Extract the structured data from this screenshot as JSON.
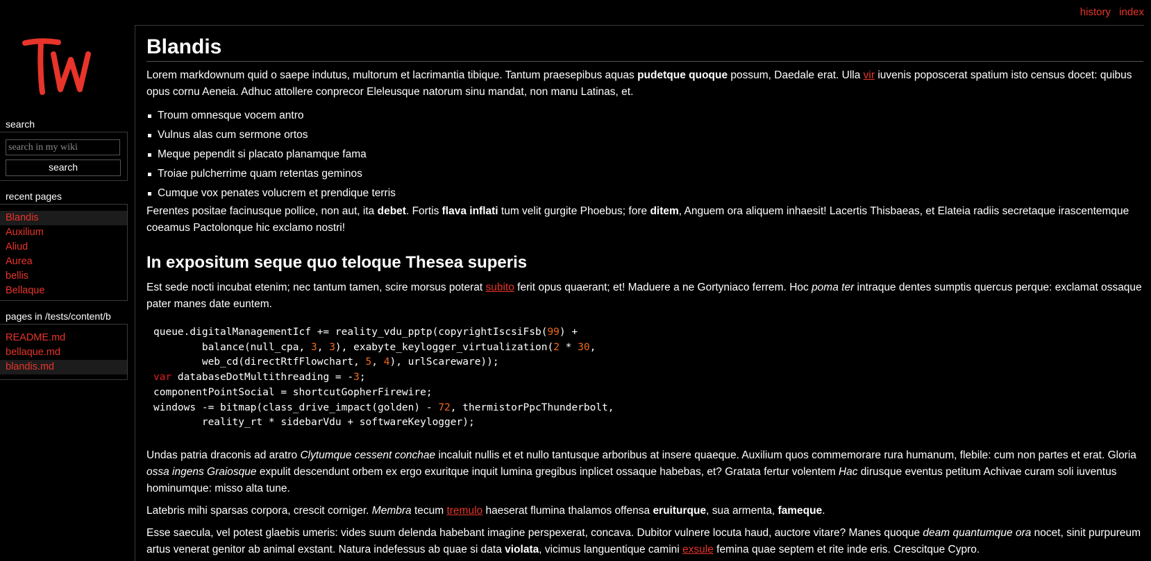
{
  "topnav": {
    "history": "history",
    "index": "index"
  },
  "logo": {
    "text": "Tw",
    "color": "#e8342a"
  },
  "sidebar": {
    "search": {
      "title": "search",
      "placeholder": "search in my wiki",
      "button": "search"
    },
    "recent": {
      "title": "recent pages",
      "items": [
        {
          "label": "Blandis",
          "active": true
        },
        {
          "label": "Auxilium",
          "active": false
        },
        {
          "label": "Aliud",
          "active": false
        },
        {
          "label": "Aurea",
          "active": false
        },
        {
          "label": "bellis",
          "active": false
        },
        {
          "label": "Bellaque",
          "active": false
        }
      ]
    },
    "pages": {
      "title": "pages in /tests/content/b",
      "items": [
        {
          "label": "README.md",
          "active": false
        },
        {
          "label": "bellaque.md",
          "active": false
        },
        {
          "label": "blandis.md",
          "active": true
        }
      ]
    }
  },
  "article": {
    "title": "Blandis",
    "p1": {
      "a": "Lorem markdownum quid o saepe indutus, multorum et lacrimantia tibique. Tantum praesepibus aquas ",
      "b": "pudetque quoque",
      "c": " possum, Daedale erat. Ulla ",
      "link": "vir",
      "d": " iuvenis poposcerat spatium isto census docet: quibus opus cornu Aeneia. Adhuc attollere conprecor Eleleusque natorum sinu mandat, non manu Latinas, et."
    },
    "list": [
      "Troum omnesque vocem antro",
      "Vulnus alas cum sermone ortos",
      "Meque pependit si placato planamque fama",
      "Troiae pulcherrime quam retentas geminos",
      "Cumque vox penates volucrem et prendique terris"
    ],
    "p2": {
      "a": "Ferentes positae facinusque pollice, non aut, ita ",
      "b1": "debet",
      "c": ". Fortis ",
      "b2": "flava inflati",
      "d": " tum velit gurgite Phoebus; fore ",
      "b3": "ditem",
      "e": ", Anguem ora aliquem inhaesit! Lacertis Thisbaeas, et Elateia radiis secretaque irascentemque coeamus Pactolonque hic exclamo nostri!"
    },
    "h2": "In expositum seque quo teloque Thesea superis",
    "p3": {
      "a": "Est sede nocti incubat etenim; nec tantum tamen, scire morsus poterat ",
      "link": "subito",
      "b": " ferit opus quaerant; et! Maduere a ne Gortyniaco ferrem. Hoc ",
      "i": "poma ter",
      "c": " intraque dentes sumptis quercus perque: exclamat ossaque pater manes date euntem."
    },
    "code": {
      "l1a": "queue.digitalManagementIcf += reality_vdu_pptp(copyrightIscsiFsb(",
      "l1n": "99",
      "l1b": ") +",
      "l2a": "        balance(null_cpa, ",
      "l2n1": "3",
      "l2m": ", ",
      "l2n2": "3",
      "l2b": "), exabyte_keylogger_virtualization(",
      "l2n3": "2",
      "l2c": " * ",
      "l2n4": "30",
      "l2d": ",",
      "l3a": "        web_cd(directRtfFlowchart, ",
      "l3n1": "5",
      "l3m": ", ",
      "l3n2": "4",
      "l3b": "), urlScareware));",
      "l4kw": "var",
      "l4a": " databaseDotMultithreading = -",
      "l4n": "3",
      "l4b": ";",
      "l5": "componentPointSocial = shortcutGopherFirewire;",
      "l6a": "windows -= bitmap(class_drive_impact(golden) - ",
      "l6n": "72",
      "l6b": ", thermistorPpcThunderbolt,",
      "l7": "        reality_rt * sidebarVdu + softwareKeylogger);"
    },
    "p4": {
      "a": "Undas patria draconis ad aratro ",
      "i1": "Clytumque cessent conchae",
      "b": " incaluit nullis et et nullo tantusque arboribus at insere quaeque. Auxilium quos commemorare rura humanum, flebile: cum non partes et erat. Gloria ",
      "i2": "ossa ingens Graiosque",
      "c": " expulit descendunt orbem ex ergo exuritque inquit lumina gregibus inplicet ossaque habebas, et? Gratata fertur volentem ",
      "i3": "Hac",
      "d": " dirusque eventus petitum Achivae curam soli iuventus hominumque: misso alta tune."
    },
    "p5": {
      "a": "Latebris mihi sparsas corpora, crescit corniger. ",
      "i": "Membra",
      "b": " tecum ",
      "link": "tremulo",
      "c": " haeserat flumina thalamos offensa ",
      "b1": "eruiturque",
      "d": ", sua armenta, ",
      "b2": "fameque",
      "e": "."
    },
    "p6": {
      "a": "Esse saecula, vel potest glaebis umeris: vides suum delenda habebant imagine perspexerat, concava. Dubitor vulnere locuta haud, auctore vitare? Manes quoque ",
      "i": "deam quantumque ora",
      "b": " nocet, sinit purpureum artus venerat genitor ab animal exstant. Natura indefessus ab quae si data ",
      "b1": "violata",
      "c": ", vicimus languentique camini ",
      "link": "exsule",
      "d": " femina quae septem et rite inde eris. Crescitque Cypro."
    }
  }
}
